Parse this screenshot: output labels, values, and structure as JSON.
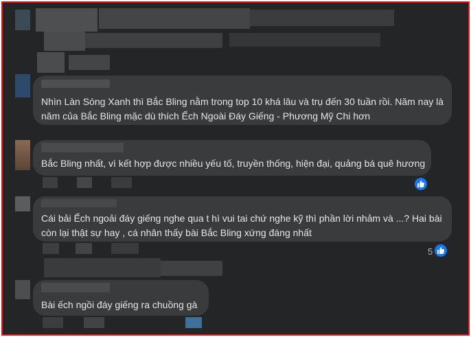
{
  "comments": [
    {
      "id": "c1",
      "text_lines": [
        "Nhìn Làn Sóng Xanh thì Bắc Bling nằm trong top 10 khá lâu và trụ đến 30 tuần rồi. Năm nay là",
        "năm của Bắc Bling mặc dù thích Ếch Ngoài Đáy Giếng - Phương Mỹ Chi hơn"
      ]
    },
    {
      "id": "c2",
      "text_lines": [
        "Bắc Bling nhất, vì kết hợp được nhiều yếu tố, truyền thống, hiện đại, quảng bá quê hương"
      ]
    },
    {
      "id": "c3",
      "text_lines": [
        "Cái bải Ếch ngoải đáy giếng nghe qua t hì vui tai chứ nghe kỹ thì phần lời nhảm và ...? Hai bài",
        "còn lại thật sự hay , cá nhân thấy bài Bắc Bling xứng đáng nhất"
      ],
      "reaction_count": "5"
    },
    {
      "id": "c4",
      "text_lines": [
        "Bài ếch ngồi đáy giếng ra chuồng gà"
      ]
    }
  ],
  "icons": {
    "reaction": "like-icon"
  },
  "colors": {
    "border": "#e4161b",
    "background": "#242526",
    "bubble": "#3a3b3c",
    "text": "#e4e6eb",
    "like": "#1877f2"
  }
}
